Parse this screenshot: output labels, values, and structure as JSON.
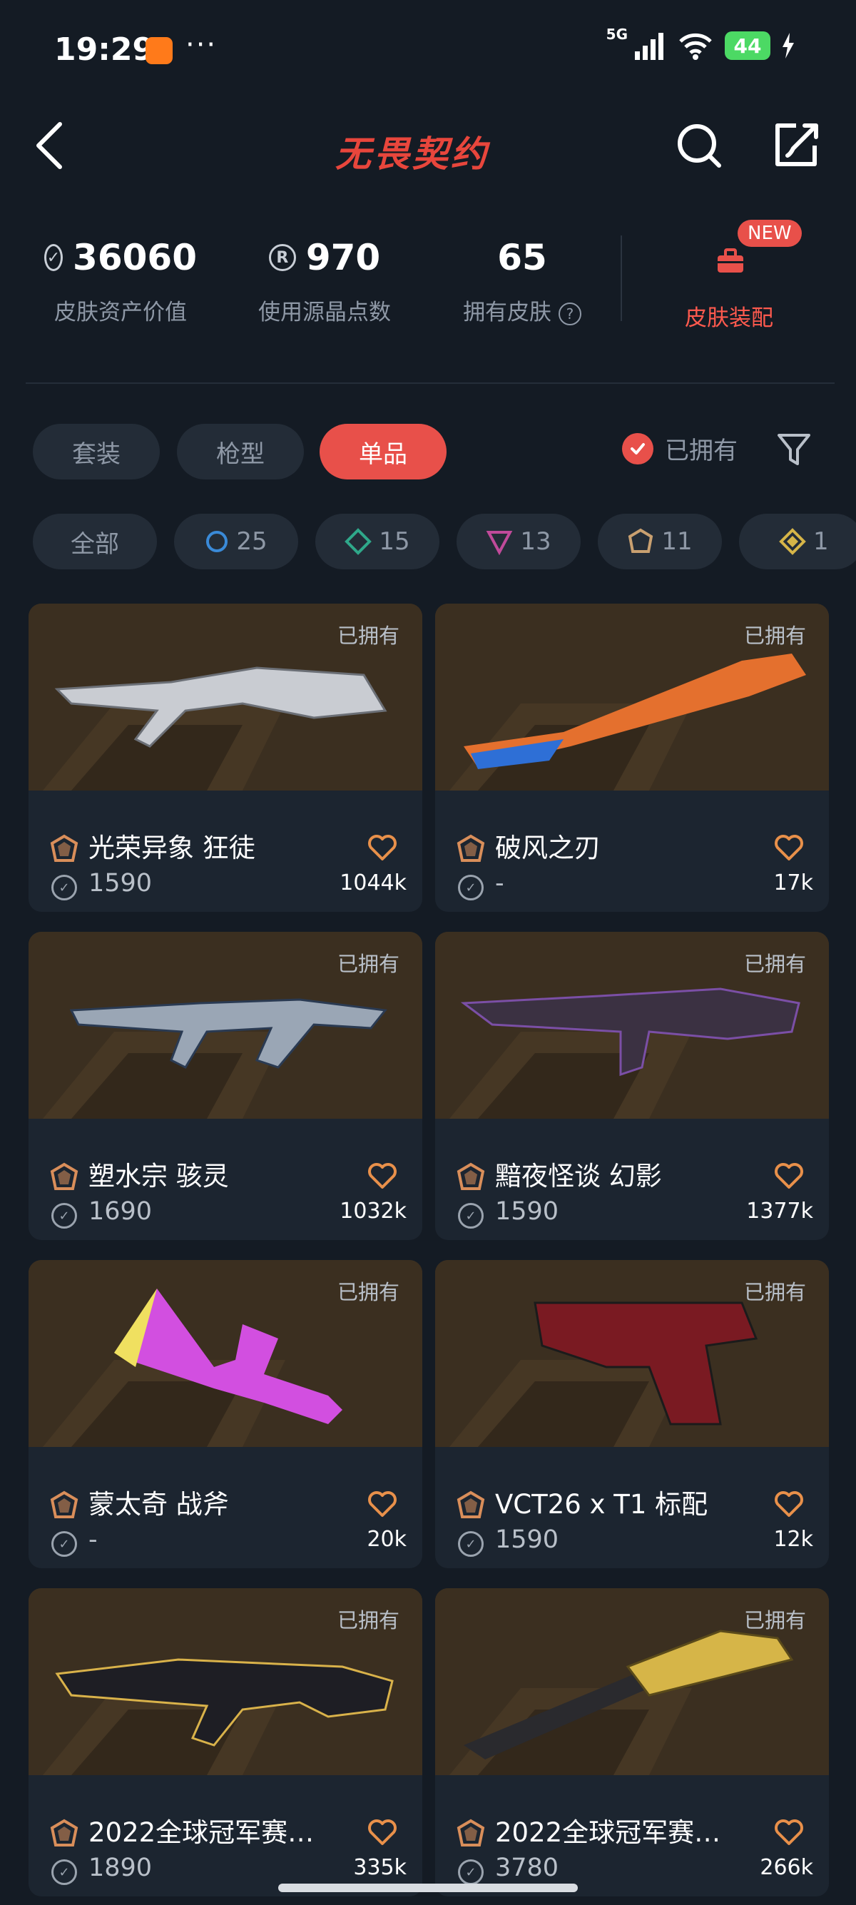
{
  "status_bar": {
    "time": "19:29",
    "more": "···",
    "network": "5G",
    "battery": "44"
  },
  "header": {
    "title": "无畏契约"
  },
  "stats": [
    {
      "value": "36060",
      "label": "皮肤资产价值",
      "icon": "vp-coin-icon"
    },
    {
      "value": "970",
      "label": "使用源晶点数",
      "icon": "radianite-icon"
    },
    {
      "value": "65",
      "label": "拥有皮肤",
      "icon": "help-icon"
    }
  ],
  "loadout": {
    "badge": "NEW",
    "label": "皮肤装配"
  },
  "tabs": [
    {
      "label": "套装",
      "active": false
    },
    {
      "label": "枪型",
      "active": false
    },
    {
      "label": "单品",
      "active": true
    }
  ],
  "owned_filter": {
    "label": "已拥有",
    "checked": true
  },
  "tiers": [
    {
      "label": "全部",
      "color": ""
    },
    {
      "label": "25",
      "color": "#3a8ad8"
    },
    {
      "label": "15",
      "color": "#2fa88a"
    },
    {
      "label": "13",
      "color": "#c04a9a"
    },
    {
      "label": "11",
      "color": "#c9a070"
    },
    {
      "label": "1",
      "color": "#d6b548"
    }
  ],
  "colors": {
    "accent": "#e8504a",
    "background": "#141b24",
    "card": "#1c2530"
  },
  "skins": [
    {
      "owned": "已拥有",
      "name": "光荣异象 狂徒",
      "price": "1590",
      "likes": "1044k",
      "tier_color": "#d98e5a"
    },
    {
      "owned": "已拥有",
      "name": "破风之刃",
      "price": "-",
      "likes": "17k",
      "tier_color": "#d98e5a"
    },
    {
      "owned": "已拥有",
      "name": "塑水宗 骇灵",
      "price": "1690",
      "likes": "1032k",
      "tier_color": "#d98e5a"
    },
    {
      "owned": "已拥有",
      "name": "黯夜怪谈 幻影",
      "price": "1590",
      "likes": "1377k",
      "tier_color": "#d98e5a"
    },
    {
      "owned": "已拥有",
      "name": "蒙太奇 战斧",
      "price": "-",
      "likes": "20k",
      "tier_color": "#d98e5a"
    },
    {
      "owned": "已拥有",
      "name": "VCT26 x T1 标配",
      "price": "1590",
      "likes": "12k",
      "tier_color": "#d98e5a"
    },
    {
      "owned": "已拥有",
      "name": "2022全球冠军赛…",
      "price": "1890",
      "likes": "335k",
      "tier_color": "#d98e5a"
    },
    {
      "owned": "已拥有",
      "name": "2022全球冠军赛…",
      "price": "3780",
      "likes": "266k",
      "tier_color": "#d98e5a"
    }
  ]
}
